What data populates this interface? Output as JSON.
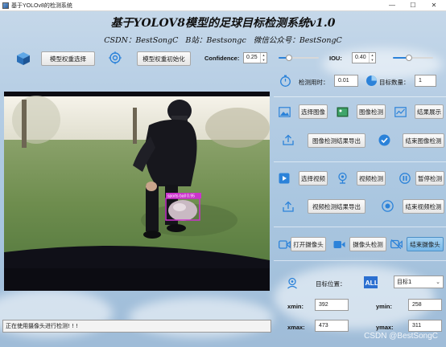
{
  "window": {
    "title": "基于YOLOv8的检测系统",
    "controls": {
      "minimize": "—",
      "maximize": "☐",
      "close": "✕"
    }
  },
  "header": {
    "title": "基于YOLOV8模型的足球目标检测系统v1.0",
    "subtitle": "CSDN：BestSongC  B站：Bestsongc  微信公众号：BestSongC"
  },
  "toolbar": {
    "select_weights": "模型权重选择",
    "init_weights": "模型权重初始化",
    "confidence_label": "Confidence:",
    "confidence_value": "0.25",
    "confidence_level": 0.25,
    "iou_label": "IOU:",
    "iou_value": "0.40",
    "iou_level": 0.4
  },
  "stats": {
    "time_label": "检测用时：",
    "time_value": "0.01",
    "count_label": "目标数量：",
    "count_value": "1"
  },
  "image_section": {
    "select": "选择图像",
    "detect": "图像检测",
    "show": "结果展示",
    "export": "图像检测结果导出",
    "stop": "结束图像检测"
  },
  "video_section": {
    "select": "选择视频",
    "detect": "视频检测",
    "pause": "暂停检测",
    "export": "视频检测结果导出",
    "stop": "结束视频检测"
  },
  "camera_section": {
    "open": "打开摄像头",
    "detect": "摄像头检测",
    "stop": "结束摄像头"
  },
  "target": {
    "position_label": "目标位置：",
    "selected": "目标1",
    "xmin_label": "xmin:",
    "xmin": "392",
    "ymin_label": "ymin:",
    "ymin": "258",
    "xmax_label": "xmax:",
    "xmax": "473",
    "ymax_label": "ymax:",
    "ymax": "311"
  },
  "detection": {
    "label": "sports ball  0.95"
  },
  "status": {
    "message": "正在使用摄像头进行检测! ! !"
  },
  "watermark": "CSDN @BestSongC",
  "colors": {
    "accent": "#2b82d9",
    "bbox": "#cc33cc",
    "active_button": "#78b8e8"
  }
}
